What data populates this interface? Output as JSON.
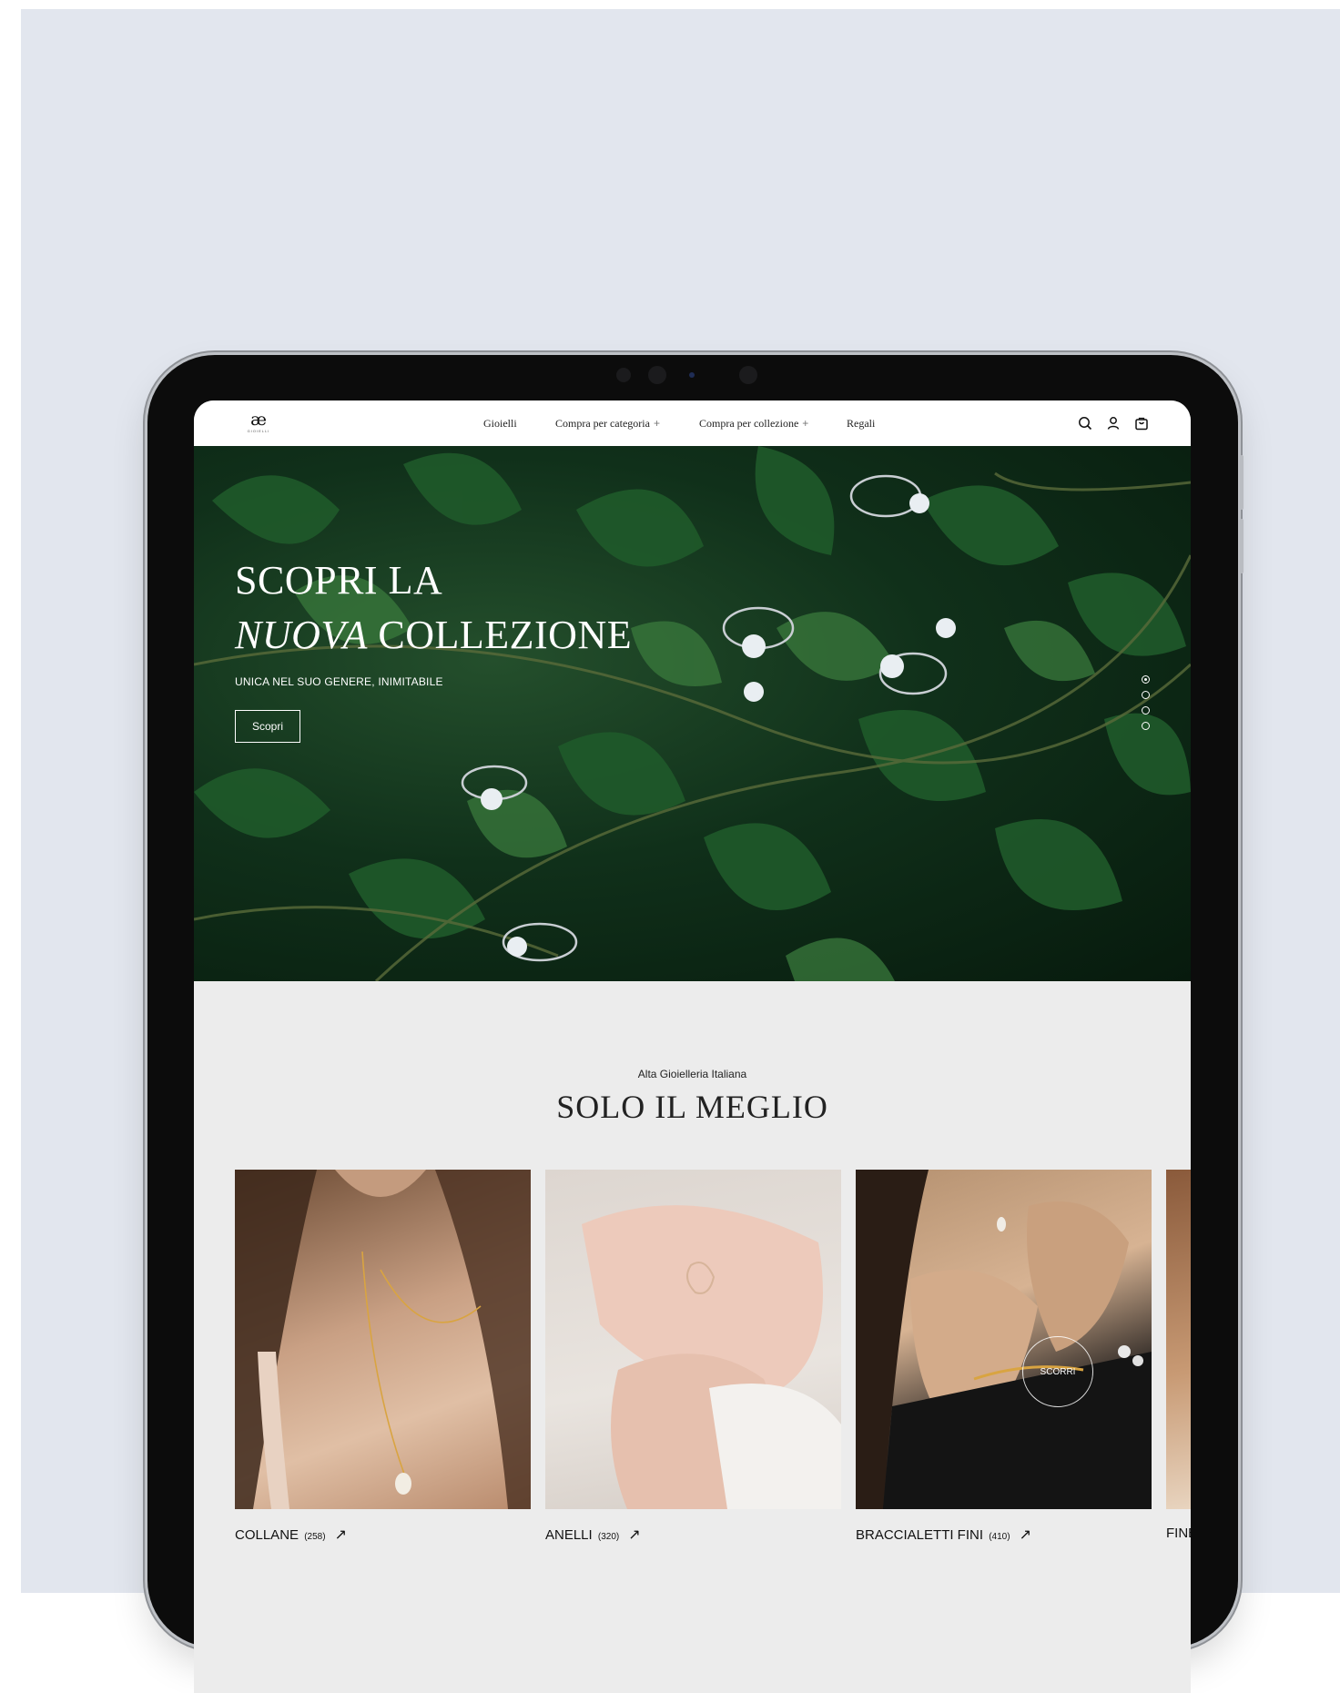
{
  "nav": {
    "logo": "æ",
    "logo_sub": "GIOIELLI",
    "links": [
      {
        "label": "Gioielli",
        "plus": ""
      },
      {
        "label": "Compra per categoria",
        "plus": "+"
      },
      {
        "label": "Compra per collezione",
        "plus": "+"
      },
      {
        "label": "Regali",
        "plus": ""
      }
    ],
    "icons": [
      "search-icon",
      "user-icon",
      "cart-icon"
    ]
  },
  "hero": {
    "title_line1": "SCOPRI LA",
    "title_italic": "NUOVA",
    "title_rest": " COLLEZIONE",
    "subtitle": "UNICA NEL SUO GENERE, INIMITABILE",
    "button": "Scopri",
    "slides": 4,
    "active_slide": 1
  },
  "section": {
    "eyebrow": "Alta Gioielleria Italiana",
    "title": "SOLO IL MEGLIO",
    "scroll_badge": "SCORRI",
    "categories": [
      {
        "name": "COLLANE",
        "count": "(258)"
      },
      {
        "name": "ANELLI",
        "count": "(320)"
      },
      {
        "name": "BRACCIALETTI FINI",
        "count": "(410)"
      },
      {
        "name": "FINE",
        "count": ""
      }
    ],
    "arrow": "↗"
  },
  "colors": {
    "backdrop": "#e2e6ee",
    "bezel": "#0c0c0c",
    "hero_green": "#10301a",
    "section_bg": "#ececec"
  }
}
